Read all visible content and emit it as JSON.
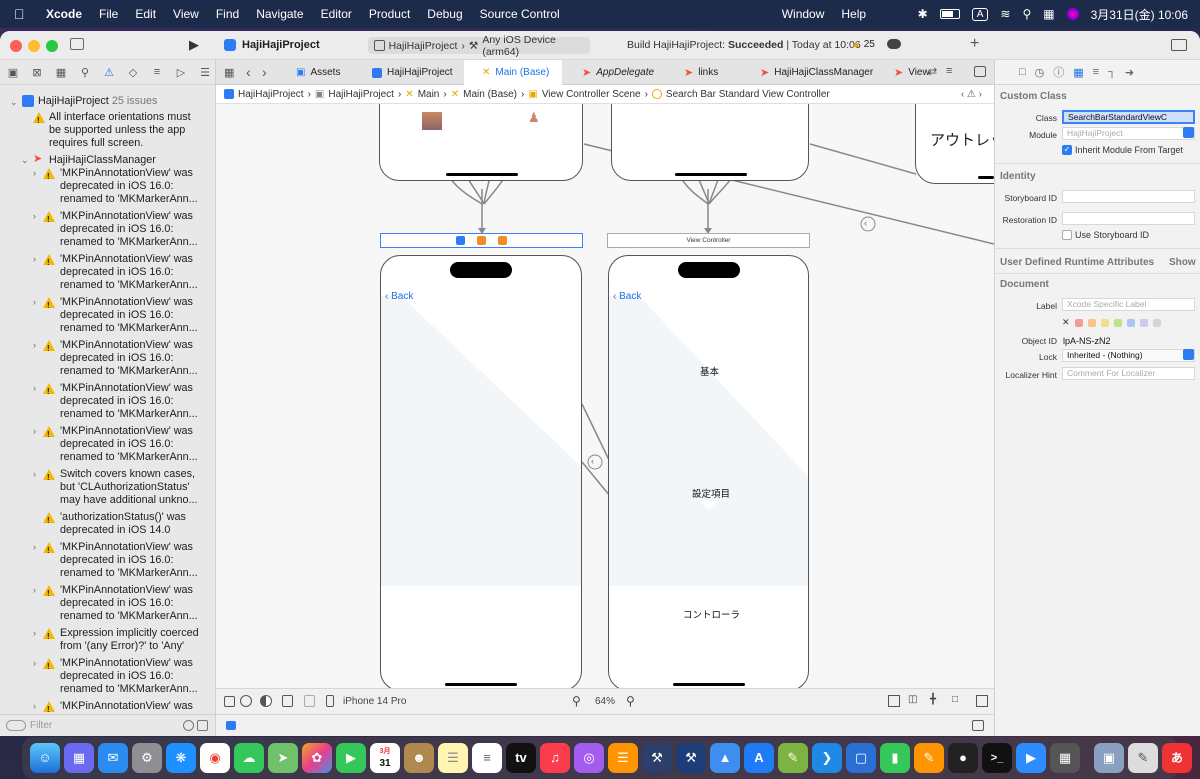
{
  "menubar": {
    "items": [
      "Xcode",
      "File",
      "Edit",
      "View",
      "Find",
      "Navigate",
      "Editor",
      "Product",
      "Debug",
      "Source Control",
      "Window",
      "Help"
    ],
    "input_mode": "A",
    "clock": "3月31日(金)  10:06"
  },
  "toolbar": {
    "project": "HajiHajiProject",
    "scheme": "HajiHajiProject",
    "destination": "Any iOS Device (arm64)",
    "build_prefix": "Build HajiHajiProject: ",
    "build_result": "Succeeded",
    "build_time": " | Today at 10:06",
    "warning_count": "25"
  },
  "navigator": {
    "root": "HajiHajiProject",
    "root_issues": "25 issues",
    "orientation_warning": [
      "All interface orientations must",
      "be supported unless the app",
      "requires full screen."
    ],
    "group": "HajiHajiClassManager",
    "issues": [
      [
        "'MKPinAnnotationView' was",
        "deprecated in iOS 16.0:",
        "renamed to 'MKMarkerAnn..."
      ],
      [
        "'MKPinAnnotationView' was",
        "deprecated in iOS 16.0:",
        "renamed to 'MKMarkerAnn..."
      ],
      [
        "'MKPinAnnotationView' was",
        "deprecated in iOS 16.0:",
        "renamed to 'MKMarkerAnn..."
      ],
      [
        "'MKPinAnnotationView' was",
        "deprecated in iOS 16.0:",
        "renamed to 'MKMarkerAnn..."
      ],
      [
        "'MKPinAnnotationView' was",
        "deprecated in iOS 16.0:",
        "renamed to 'MKMarkerAnn..."
      ],
      [
        "'MKPinAnnotationView' was",
        "deprecated in iOS 16.0:",
        "renamed to 'MKMarkerAnn..."
      ],
      [
        "'MKPinAnnotationView' was",
        "deprecated in iOS 16.0:",
        "renamed to 'MKMarkerAnn..."
      ],
      [
        "Switch covers known cases,",
        "but 'CLAuthorizationStatus'",
        "may have additional unkno..."
      ],
      [
        "'authorizationStatus()' was",
        "deprecated in iOS 14.0"
      ],
      [
        "'MKPinAnnotationView' was",
        "deprecated in iOS 16.0:",
        "renamed to 'MKMarkerAnn..."
      ],
      [
        "'MKPinAnnotationView' was",
        "deprecated in iOS 16.0:",
        "renamed to 'MKMarkerAnn..."
      ],
      [
        "Expression implicitly coerced",
        "from '(any Error)?' to 'Any'"
      ],
      [
        "'MKPinAnnotationView' was",
        "deprecated in iOS 16.0:",
        "renamed to 'MKMarkerAnn..."
      ],
      [
        "'MKPinAnnotationView' was"
      ]
    ],
    "filter_placeholder": "Filter"
  },
  "tabs": [
    "Assets",
    "HajiHajiProject",
    "Main (Base)",
    "AppDelegate",
    "links",
    "HajiHajiClassManager",
    "View"
  ],
  "jumpbar": [
    "HajiHajiProject",
    "HajiHajiProject",
    "Main",
    "Main (Base)",
    "View Controller Scene",
    "Search Bar Standard View Controller"
  ],
  "canvas": {
    "left_scene_back": "Back",
    "right_scene_title": "View Controller",
    "right_scene_back": "Back",
    "label_basic": "基本",
    "label_settings": "設定項目",
    "label_controller": "コントローラ",
    "outlet_text": "アウトレッ",
    "device": "iPhone 14 Pro",
    "zoom": "64%"
  },
  "inspector": {
    "custom_class_header": "Custom Class",
    "class_label": "Class",
    "class_value": "SearchBarStandardViewC",
    "module_label": "Module",
    "module_placeholder": "HajiHajiProject",
    "inherit_label": "Inherit Module From Target",
    "identity_header": "Identity",
    "storyboard_id_label": "Storyboard ID",
    "restoration_id_label": "Restoration ID",
    "use_storyboard_id_label": "Use Storyboard ID",
    "runtime_attrs_header": "User Defined Runtime Attributes",
    "runtime_attrs_show": "Show",
    "document_header": "Document",
    "doc_label_label": "Label",
    "doc_label_placeholder": "Xcode Specific Label",
    "object_id_label": "Object ID",
    "object_id_value": "lpA-NS-zN2",
    "lock_label": "Lock",
    "lock_value": "Inherited - (Nothing)",
    "localizer_label": "Localizer Hint",
    "localizer_placeholder": "Comment For Localizer"
  },
  "dock": {
    "calendar_month": "3月",
    "calendar_day": "31"
  }
}
